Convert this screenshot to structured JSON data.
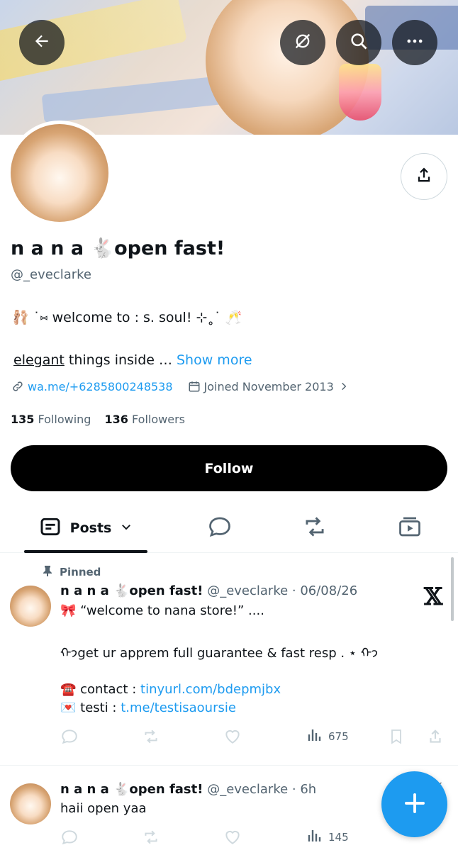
{
  "header": {
    "back_icon": "arrow-left-icon",
    "privacy_icon": "eye-slash-icon",
    "search_icon": "search-icon",
    "more_icon": "more-horizontal-icon"
  },
  "profile": {
    "display_name": "n a n a 🐇open fast!",
    "handle": "@_eveclarke",
    "bio_line1": "🩰 ˙⑅ welcome to : s. soul! ⊹˳˙ 🥂",
    "bio_line2_underlined": "elegant",
    "bio_line2_rest": " things inside …",
    "show_more": "Show more",
    "website": "wa.me/+6285800248538",
    "joined": "Joined November 2013",
    "following_count": "135",
    "following_label": "Following",
    "followers_count": "136",
    "followers_label": "Followers",
    "follow_button": "Follow"
  },
  "tabs": [
    {
      "label": "Posts",
      "icon": "posts-icon",
      "active": true
    },
    {
      "icon": "reply-bubble-icon"
    },
    {
      "icon": "repost-icon"
    },
    {
      "icon": "media-icon"
    }
  ],
  "posts": [
    {
      "pinned_label": "Pinned",
      "name": "n a n a 🐇open fast!",
      "meta": "@_eveclarke · 06/08/26",
      "line1": "🎀 “welcome to nana store!” ....",
      "line2": "ᡣ𐭩get ur apprem full guarantee & fast resp . ⋆ ᡣ𐭩",
      "line3_prefix": "☎️ contact : ",
      "line3_link": "tinyurl.com/bdepmjbx",
      "line4_prefix": "💌 testi : ",
      "line4_link": "t.me/testisaoursie",
      "views": "675"
    },
    {
      "name": "n a n a 🐇open fast!",
      "meta": "@_eveclarke · 6h",
      "line1": "haii open yaa",
      "views": "145"
    }
  ],
  "colors": {
    "accent": "#1d9bf0",
    "text": "#0f1419",
    "secondary": "#536471",
    "follow_bg": "#000000"
  }
}
